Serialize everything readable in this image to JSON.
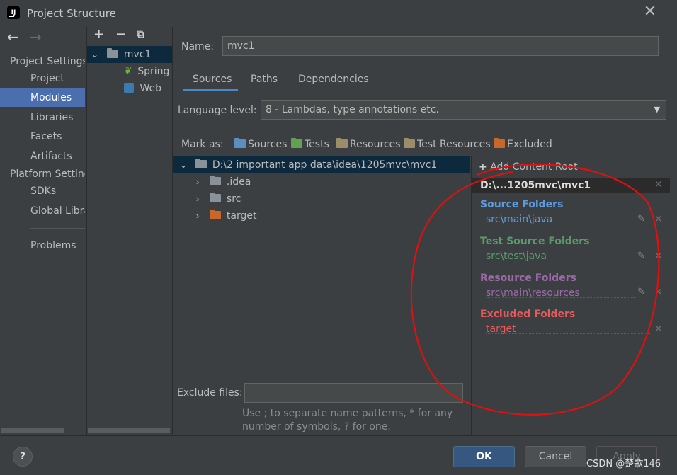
{
  "window": {
    "title": "Project Structure",
    "logo_text": "IJ"
  },
  "left_nav": {
    "groups": [
      {
        "label": "Project Settings",
        "items": [
          "Project",
          "Modules",
          "Libraries",
          "Facets",
          "Artifacts"
        ]
      },
      {
        "label": "Platform Settings",
        "items": [
          "SDKs",
          "Global Libraries"
        ]
      }
    ],
    "problems": "Problems",
    "selected": "Modules"
  },
  "modules": {
    "root": "mvc1",
    "children": [
      "Spring",
      "Web"
    ]
  },
  "main": {
    "name_label": "Name:",
    "name_value": "mvc1",
    "tabs": [
      "Sources",
      "Paths",
      "Dependencies"
    ],
    "active_tab": "Sources",
    "language_label": "Language level:",
    "language_value": "8 - Lambdas, type annotations etc.",
    "mark_as_label": "Mark as:",
    "mark_as": [
      "Sources",
      "Tests",
      "Resources",
      "Test Resources",
      "Excluded"
    ],
    "tree": {
      "root": "D:\\2 important app data\\idea\\1205mvc\\mvc1",
      "children": [
        ".idea",
        "src",
        "target"
      ]
    },
    "exclude_label": "Exclude files:",
    "exclude_value": "",
    "exclude_hint_line1": "Use ; to separate name patterns, * for any",
    "exclude_hint_line2": "number of symbols, ? for one."
  },
  "content_root": {
    "add_label": "Add Content Root",
    "path": "D:\\...1205mvc\\mvc1",
    "sections": [
      {
        "title": "Source Folders",
        "item": "src\\main\\java",
        "color": "#5f9bdc"
      },
      {
        "title": "Test Source Folders",
        "item": "src\\test\\java",
        "color": "#5a9b6a"
      },
      {
        "title": "Resource Folders",
        "item": "src\\main\\resources",
        "color": "#9a6aa6"
      },
      {
        "title": "Excluded Folders",
        "item": "target",
        "color": "#e8595a"
      }
    ]
  },
  "buttons": {
    "help": "?",
    "ok": "OK",
    "cancel": "Cancel",
    "apply": "Apply"
  },
  "watermark": "CSDN @楚歌146",
  "colors": {
    "accent": "#4b6eaf",
    "annotation": "#e01010"
  }
}
